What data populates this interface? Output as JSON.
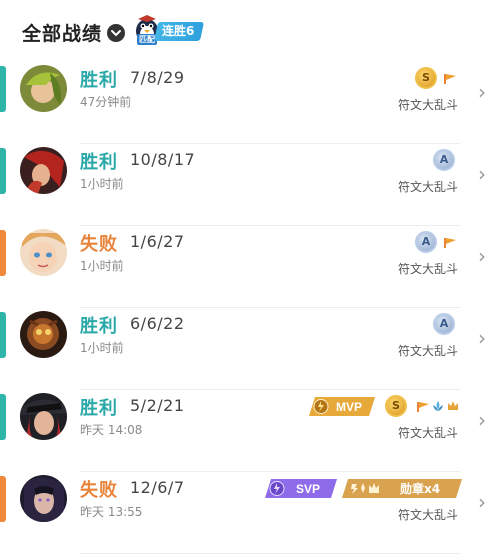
{
  "header": {
    "title": "全部战绩",
    "streak_tag": "匹配",
    "streak_label": "连胜6"
  },
  "colors": {
    "win": "#2aa9a8",
    "loss": "#e8843a",
    "win_bar": "#2fb5a8",
    "loss_bar": "#f08a3a"
  },
  "matches": [
    {
      "result": "胜利",
      "outcome": "win",
      "kda": "7/8/29",
      "time": "47分钟前",
      "mode": "符文大乱斗",
      "rank": "S",
      "icons": [
        "flag-icon"
      ]
    },
    {
      "result": "胜利",
      "outcome": "win",
      "kda": "10/8/17",
      "time": "1小时前",
      "mode": "符文大乱斗",
      "rank": "A",
      "icons": []
    },
    {
      "result": "失败",
      "outcome": "loss",
      "kda": "1/6/27",
      "time": "1小时前",
      "mode": "符文大乱斗",
      "rank": "A",
      "icons": [
        "flag-icon"
      ]
    },
    {
      "result": "胜利",
      "outcome": "win",
      "kda": "6/6/22",
      "time": "1小时前",
      "mode": "符文大乱斗",
      "rank": "A",
      "icons": []
    },
    {
      "result": "胜利",
      "outcome": "win",
      "kda": "5/2/21",
      "time": "昨天 14:08",
      "mode": "符文大乱斗",
      "rank": "S",
      "badge": "MVP",
      "icons": [
        "flag-icon",
        "lotus-icon",
        "crown-icon"
      ]
    },
    {
      "result": "失败",
      "outcome": "loss",
      "kda": "12/6/7",
      "time": "昨天 13:55",
      "mode": "符文大乱斗",
      "badge": "SVP",
      "medal": "勋章x4",
      "icons": []
    }
  ]
}
